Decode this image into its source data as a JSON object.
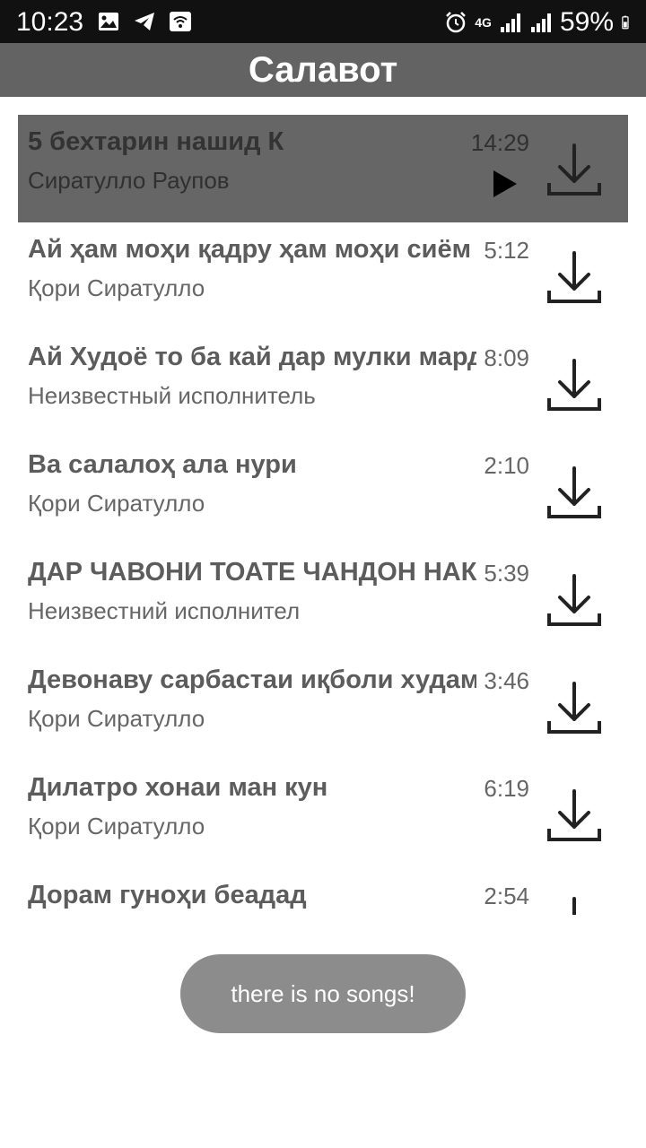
{
  "status_bar": {
    "time": "10:23",
    "network": "4G",
    "battery": "59%",
    "left_icons": [
      "image-icon",
      "telegram-icon",
      "wifi-hotspot-icon"
    ],
    "right_icons": [
      "alarm-icon",
      "signal-icon",
      "signal-icon",
      "battery-icon"
    ]
  },
  "app_bar": {
    "title": "Салавот",
    "background": "#636363"
  },
  "songs": [
    {
      "title": "5 бехтарин нашид К",
      "artist": "Сиратулло Раупов",
      "duration": "14:29",
      "selected": true
    },
    {
      "title": "Ай ҳам моҳи қадру ҳам моҳи сиём",
      "artist": "Қори Сиратулло",
      "duration": "5:12",
      "selected": false
    },
    {
      "title": "Ай Худоё то ба кай дар мулки мардум",
      "artist": "Неизвестный исполнитель",
      "duration": "8:09",
      "selected": false
    },
    {
      "title": "Ва салалоҳ ала нури",
      "artist": "Қори Сиратулло",
      "duration": "2:10",
      "selected": false
    },
    {
      "title": "ДАР ЧАВОНИ ТОАТЕ ЧАНДОН НАКАРДИ",
      "artist": "Неизвестний исполнител",
      "duration": "5:39",
      "selected": false
    },
    {
      "title": "Девонаву сарбастаи иқболи худам",
      "artist": "Қори Сиратулло",
      "duration": "3:46",
      "selected": false
    },
    {
      "title": "Дилатро хонаи ман кун",
      "artist": "Қори Сиратулло",
      "duration": "6:19",
      "selected": false
    },
    {
      "title": "Дорам гуноҳи беадад",
      "artist": "",
      "duration": "2:54",
      "selected": false
    }
  ],
  "toast": {
    "message": "there is no songs!"
  },
  "icons": {
    "play": "play-icon",
    "download": "download-icon"
  },
  "colors": {
    "selected_row": "#666666",
    "toast_bg": "#8c8c8c"
  }
}
